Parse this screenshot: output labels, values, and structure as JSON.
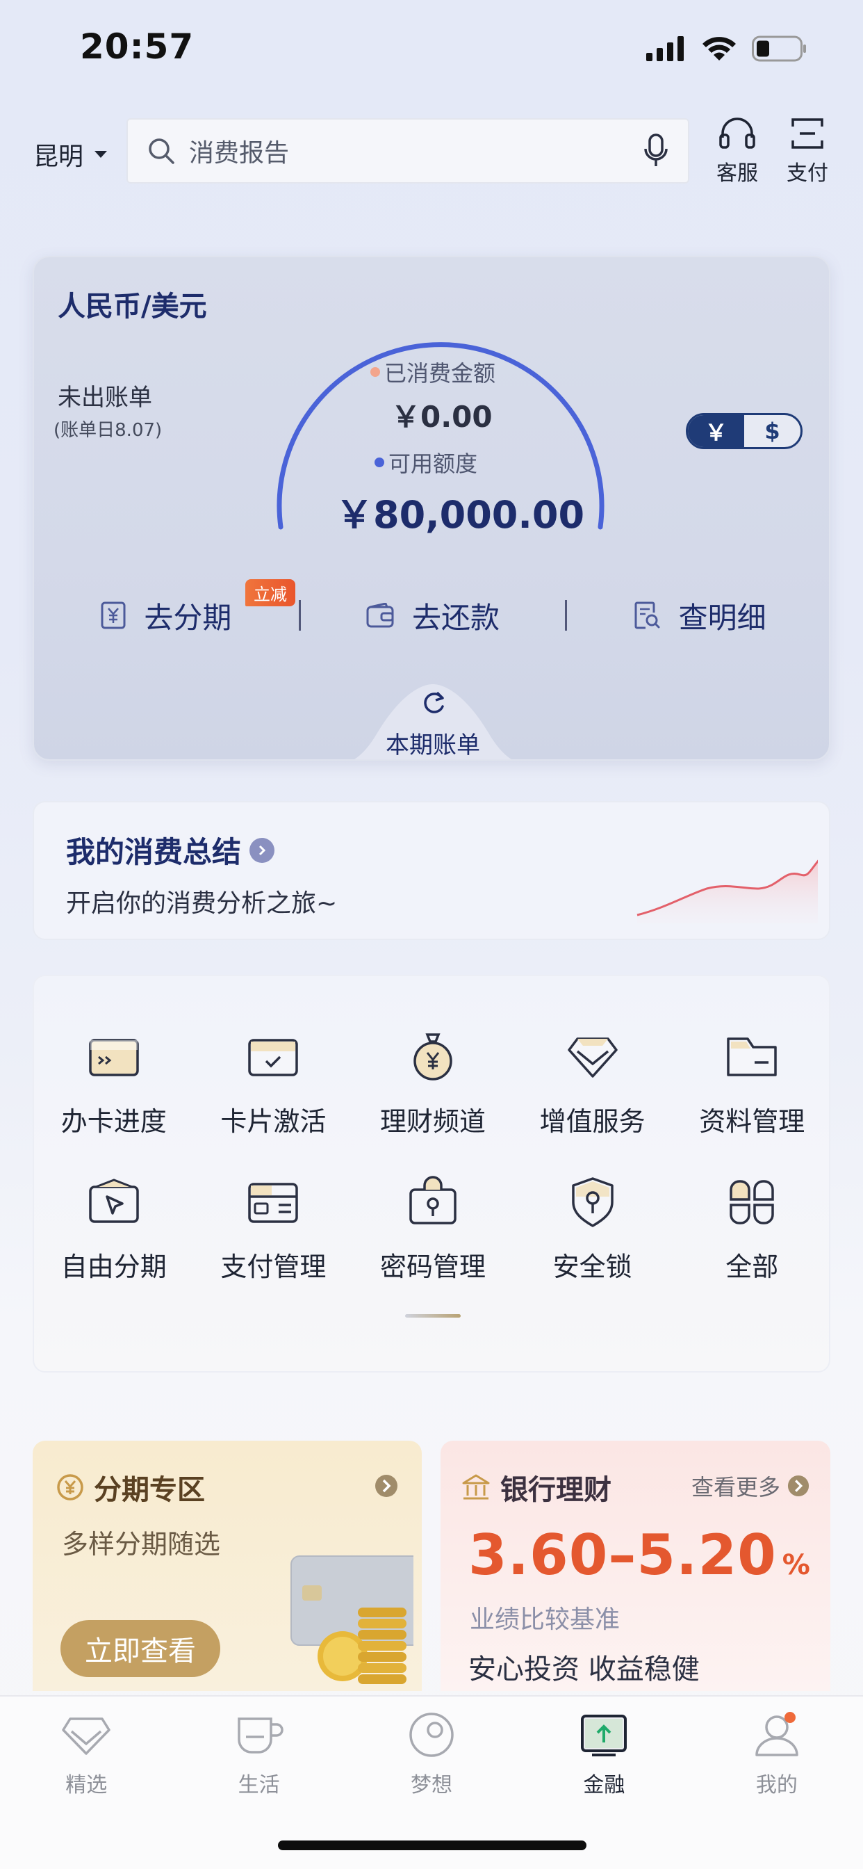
{
  "status_bar": {
    "time": "20:57"
  },
  "header": {
    "city": "昆明",
    "search_placeholder": "消费报告",
    "actions": [
      {
        "label": "客服",
        "icon": "headset-icon"
      },
      {
        "label": "支付",
        "icon": "scan-pay-icon"
      }
    ]
  },
  "credit_card": {
    "title": "人民币/美元",
    "bill_status": "未出账单",
    "bill_date": "(账单日8.07)",
    "spent_label": "已消费金额",
    "spent_value": "￥0.00",
    "available_label": "可用额度",
    "available_value": "￥80,000.00",
    "currency_options": [
      "￥",
      "$"
    ],
    "selected_currency": "￥",
    "actions": [
      {
        "label": "去分期",
        "icon": "yuan-doc-icon",
        "badge": "立减"
      },
      {
        "label": "去还款",
        "icon": "wallet-icon"
      },
      {
        "label": "查明细",
        "icon": "search-doc-icon"
      }
    ],
    "current_bill_tab": "本期账单",
    "colors": {
      "gauge": "#4a63d8",
      "spent_dot": "#f3a58c",
      "available_dot": "#4a63d8"
    }
  },
  "summary": {
    "title": "我的消费总结",
    "subtitle": "开启你的消费分析之旅~"
  },
  "menu": {
    "items": [
      {
        "label": "办卡进度",
        "icon": "card-progress-icon"
      },
      {
        "label": "卡片激活",
        "icon": "card-activate-icon"
      },
      {
        "label": "理财频道",
        "icon": "money-bag-icon"
      },
      {
        "label": "增值服务",
        "icon": "diamond-icon"
      },
      {
        "label": "资料管理",
        "icon": "folder-icon"
      },
      {
        "label": "自由分期",
        "icon": "installment-icon"
      },
      {
        "label": "支付管理",
        "icon": "payment-card-icon"
      },
      {
        "label": "密码管理",
        "icon": "lock-icon"
      },
      {
        "label": "安全锁",
        "icon": "shield-key-icon"
      },
      {
        "label": "全部",
        "icon": "grid-all-icon"
      }
    ]
  },
  "promo_installment": {
    "title": "分期专区",
    "subtitle": "多样分期随选",
    "button": "立即查看"
  },
  "promo_wealth": {
    "title": "银行理财",
    "more": "查看更多",
    "rate": "3.60–5.20",
    "rate_unit": "%",
    "benchmark": "业绩比较基准",
    "slogan": "安心投资 收益稳健"
  },
  "tabbar": {
    "tabs": [
      {
        "label": "精选",
        "icon": "diamond-tab-icon"
      },
      {
        "label": "生活",
        "icon": "cup-icon"
      },
      {
        "label": "梦想",
        "icon": "dream-icon"
      },
      {
        "label": "金融",
        "icon": "finance-icon",
        "active": true
      },
      {
        "label": "我的",
        "icon": "profile-icon",
        "dot": true
      }
    ]
  }
}
